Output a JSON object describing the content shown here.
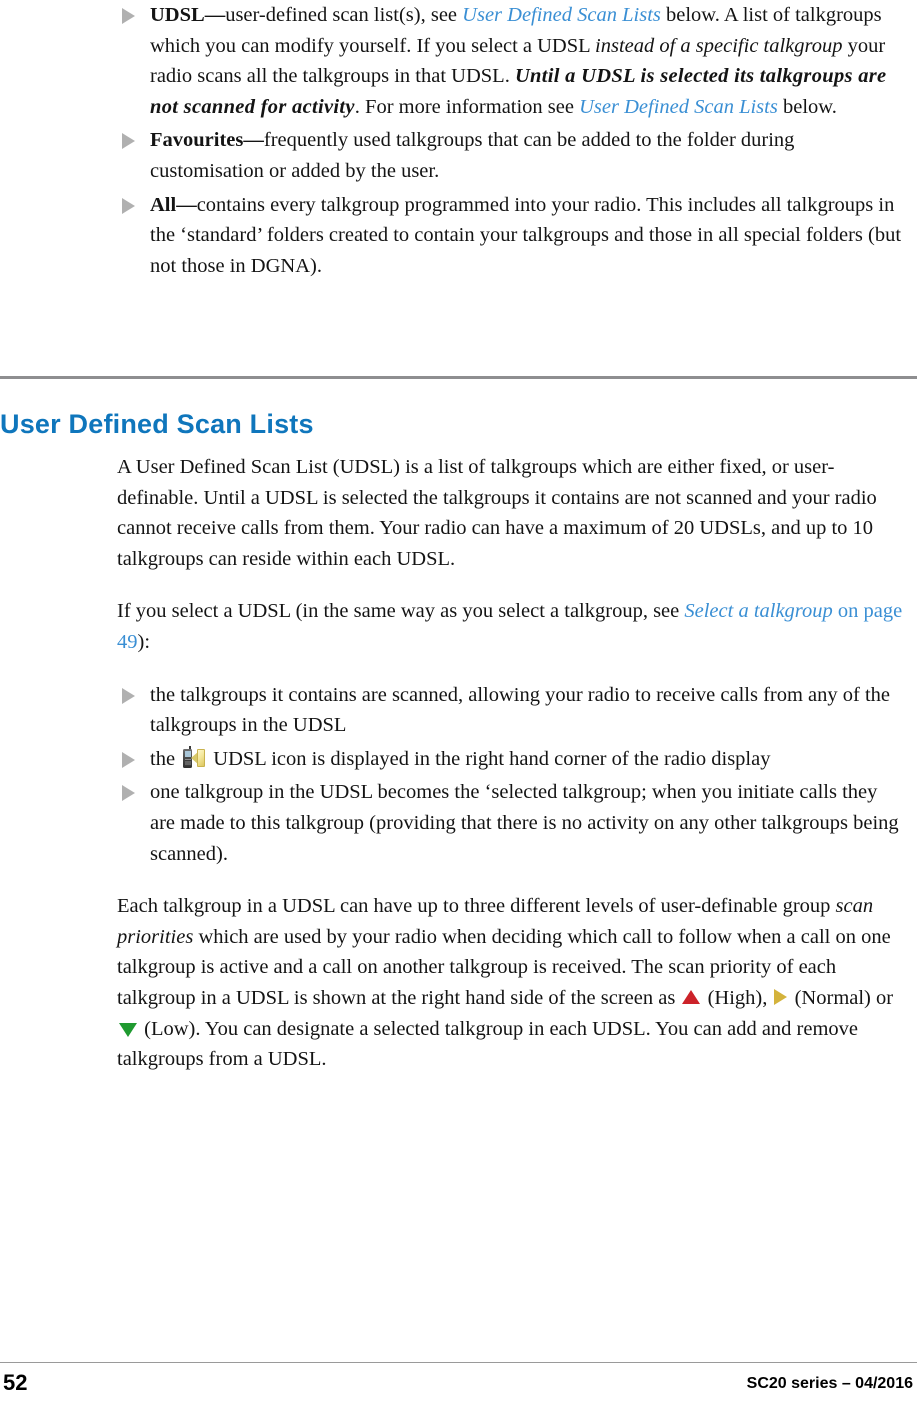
{
  "document": {
    "page_number": "52",
    "doc_reference": "SC20 series – 04/2016"
  },
  "folder_types_list": [
    {
      "term": "UDSL",
      "dash": "—",
      "text_1": "user-defined scan list(s), see ",
      "xref_1": "User Defined Scan Lists",
      "text_2": " below. A list of talkgroups which you can modify yourself. If you select a UDSL ",
      "italic_1": "instead of a specific talkgroup",
      "text_3": " your radio scans all the talkgroups in that UDSL. ",
      "bolditalic_1": "Until a UDSL is selected its talkgroups are not scanned for activity",
      "text_4": ". For more information see ",
      "xref_2": "User Defined Scan Lists",
      "text_5": " below."
    },
    {
      "term": "Favourites",
      "dash": "—",
      "text_1": "frequently used talkgroups that can be added to the folder during customisation or added by the user."
    },
    {
      "term": "All",
      "dash": "—",
      "text_1": "contains every talkgroup programmed into your radio. This includes all talkgroups in the ‘standard’ folders created to contain your talkgroups and those in all special folders (but not those in DGNA)."
    }
  ],
  "section": {
    "heading": "User Defined Scan Lists",
    "heading_color": "#0f76bc",
    "rule_color": "#8e8e90",
    "intro_paragraph": "A User Defined Scan List (UDSL) is a list of talkgroups which are either fixed, or user-definable. Until a UDSL is selected the talkgroups it contains are not scanned and your radio cannot receive calls from them. Your radio can have a maximum of 20 UDSLs, and up to 10 talkgroups can reside within each UDSL.",
    "select_paragraph": {
      "text_1": "If you select a UDSL (in the same way as you select a talkgroup, see ",
      "xref_italic": "Select a talkgroup",
      "xref_plain": " on page 49",
      "text_2": "):"
    },
    "udsl_effects_list": [
      {
        "text_1": "the talkgroups it contains are scanned, allowing your radio to receive calls from any of the talkgroups in the UDSL"
      },
      {
        "text_1": "the ",
        "icon": "udsl-radio-icon",
        "text_2": " UDSL icon is displayed in the right hand corner of the radio display"
      },
      {
        "text_1": "one talkgroup in the UDSL becomes the ‘selected talkgroup; when you initiate calls they are made to this talkgroup (providing that there is no activity on any other talkgroups being scanned)."
      }
    ],
    "priorities_paragraph": {
      "text_1": "Each talkgroup in a UDSL can have up to three different levels of user-definable group ",
      "italic_1": "scan priorities",
      "text_2": " which are used by your radio when deciding which call to follow when a call on one talkgroup is active and a call on another talkgroup is received. The scan priority of each talkgroup in a UDSL is shown at the right hand side of the screen as ",
      "icon_high": "priority-high-icon",
      "label_high": " (High), ",
      "icon_normal": "priority-normal-icon",
      "label_normal": " (Normal) or ",
      "icon_low": "priority-low-icon",
      "label_low": " (Low). You can designate a selected talkgroup in each UDSL. You can add and remove talkgroups from a UDSL."
    }
  },
  "colors": {
    "heading_blue": "#0f76bc",
    "xref_blue": "#3a8fd4",
    "bullet_grey": "#b0b0b0",
    "rule_grey": "#8e8e90",
    "priority_high_red": "#cc2229",
    "priority_normal_yellow": "#d4b33c",
    "priority_low_green": "#1f9a30"
  }
}
